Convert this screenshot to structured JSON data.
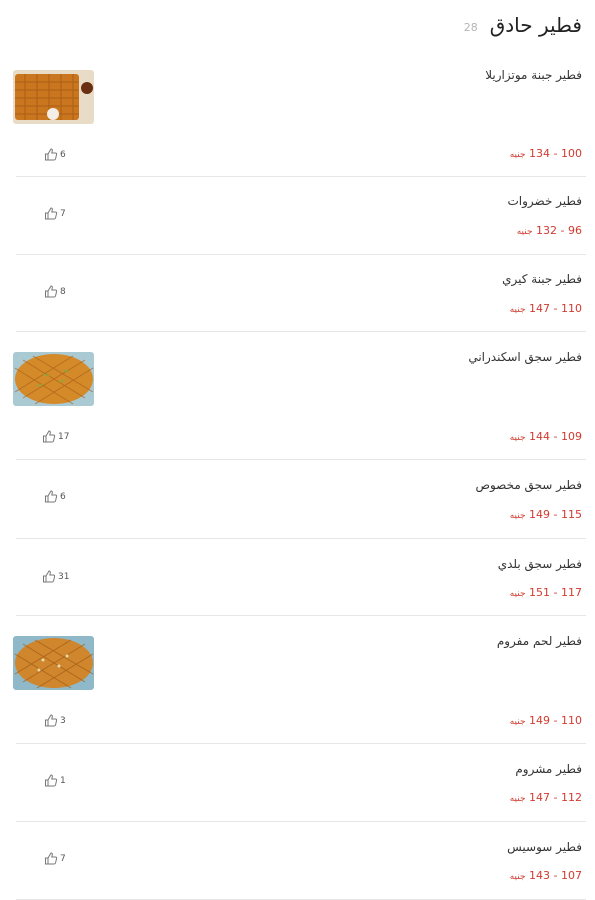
{
  "header": {
    "title": "فطير حادق",
    "count": "28"
  },
  "currency": "جنيه",
  "items": [
    {
      "name": "فطير جبنة موتزاريلا",
      "price": "100 - 134",
      "likes": "6",
      "has_image": true
    },
    {
      "name": "فطير خضروات",
      "price": "96 - 132",
      "likes": "7",
      "has_image": false
    },
    {
      "name": "فطير جبنة كيري",
      "price": "110 - 147",
      "likes": "8",
      "has_image": false
    },
    {
      "name": "فطير سجق اسكندراني",
      "price": "109 - 144",
      "likes": "17",
      "has_image": true
    },
    {
      "name": "فطير سجق مخصوص",
      "price": "115 - 149",
      "likes": "6",
      "has_image": false
    },
    {
      "name": "فطير سجق بلدي",
      "price": "117 - 151",
      "likes": "31",
      "has_image": false
    },
    {
      "name": "فطير لحم مفروم",
      "price": "110 - 149",
      "likes": "3",
      "has_image": true
    },
    {
      "name": "فطير مشروم",
      "price": "112 - 147",
      "likes": "1",
      "has_image": false
    },
    {
      "name": "فطير سوسيس",
      "price": "107 - 143",
      "likes": "7",
      "has_image": false
    }
  ]
}
